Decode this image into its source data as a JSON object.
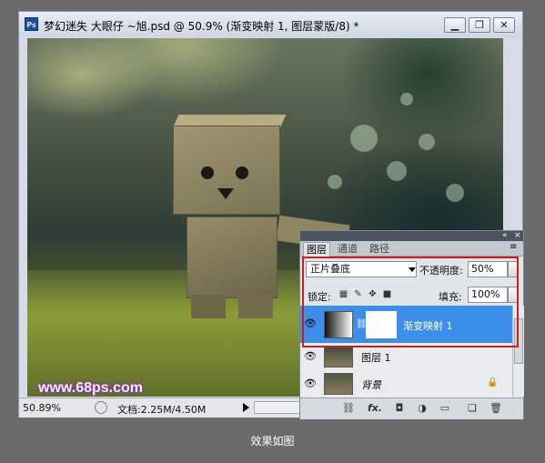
{
  "window": {
    "icon_label": "Ps",
    "title": "梦幻迷失 大眼仔 ~旭.psd @ 50.9% (渐变映射 1, 图层蒙版/8) *",
    "buttons": {
      "minimize": "▁",
      "restore": "❐",
      "close": "✕"
    }
  },
  "canvas": {
    "watermark": "www.68ps.com"
  },
  "statusbar": {
    "zoom": "50.89%",
    "doc_info": "文档:2.25M/4.50M"
  },
  "layers_panel": {
    "tabs": [
      "图层",
      "通道",
      "路径"
    ],
    "blend_mode": "正片叠底",
    "opacity_label": "不透明度:",
    "opacity_value": "50%",
    "lock_label": "锁定:",
    "fill_label": "填充:",
    "fill_value": "100%",
    "layers": [
      {
        "name": "渐变映射 1",
        "selected": true
      },
      {
        "name": "图层 1",
        "selected": false
      },
      {
        "name": "背景",
        "selected": false,
        "locked": true
      }
    ],
    "bottom_icons": [
      "link-icon",
      "fx-icon",
      "mask-icon",
      "adjustment-icon",
      "group-icon",
      "new-layer-icon",
      "trash-icon"
    ],
    "fx_label": "fx."
  },
  "caption": "效果如图",
  "colors": {
    "selection": "#3d8ee8",
    "highlight_box": "#cc1e1e",
    "watermark_glow": "#8b2fb5"
  }
}
